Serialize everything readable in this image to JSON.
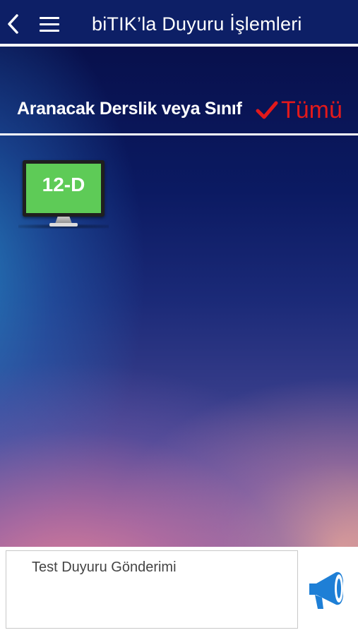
{
  "header": {
    "title": "biTIK’la Duyuru İşlemleri",
    "back_icon": "chevron-left-icon",
    "menu_icon": "hamburger-menu-icon"
  },
  "filter": {
    "label": "Aranacak Derslik veya Sınıf",
    "all_label": "Tümü",
    "all_icon": "checkmark-icon",
    "accent_color": "#e2191b"
  },
  "classes": [
    {
      "label": "12-D",
      "icon": "monitor-icon",
      "screen_color": "#5ecb57"
    }
  ],
  "composer": {
    "message_value": "Test Duyuru Gönderimi",
    "send_icon": "megaphone-icon",
    "send_color": "#1e7fd6"
  },
  "colors": {
    "header_bg": "#0d1f66",
    "divider": "#ffffff"
  }
}
